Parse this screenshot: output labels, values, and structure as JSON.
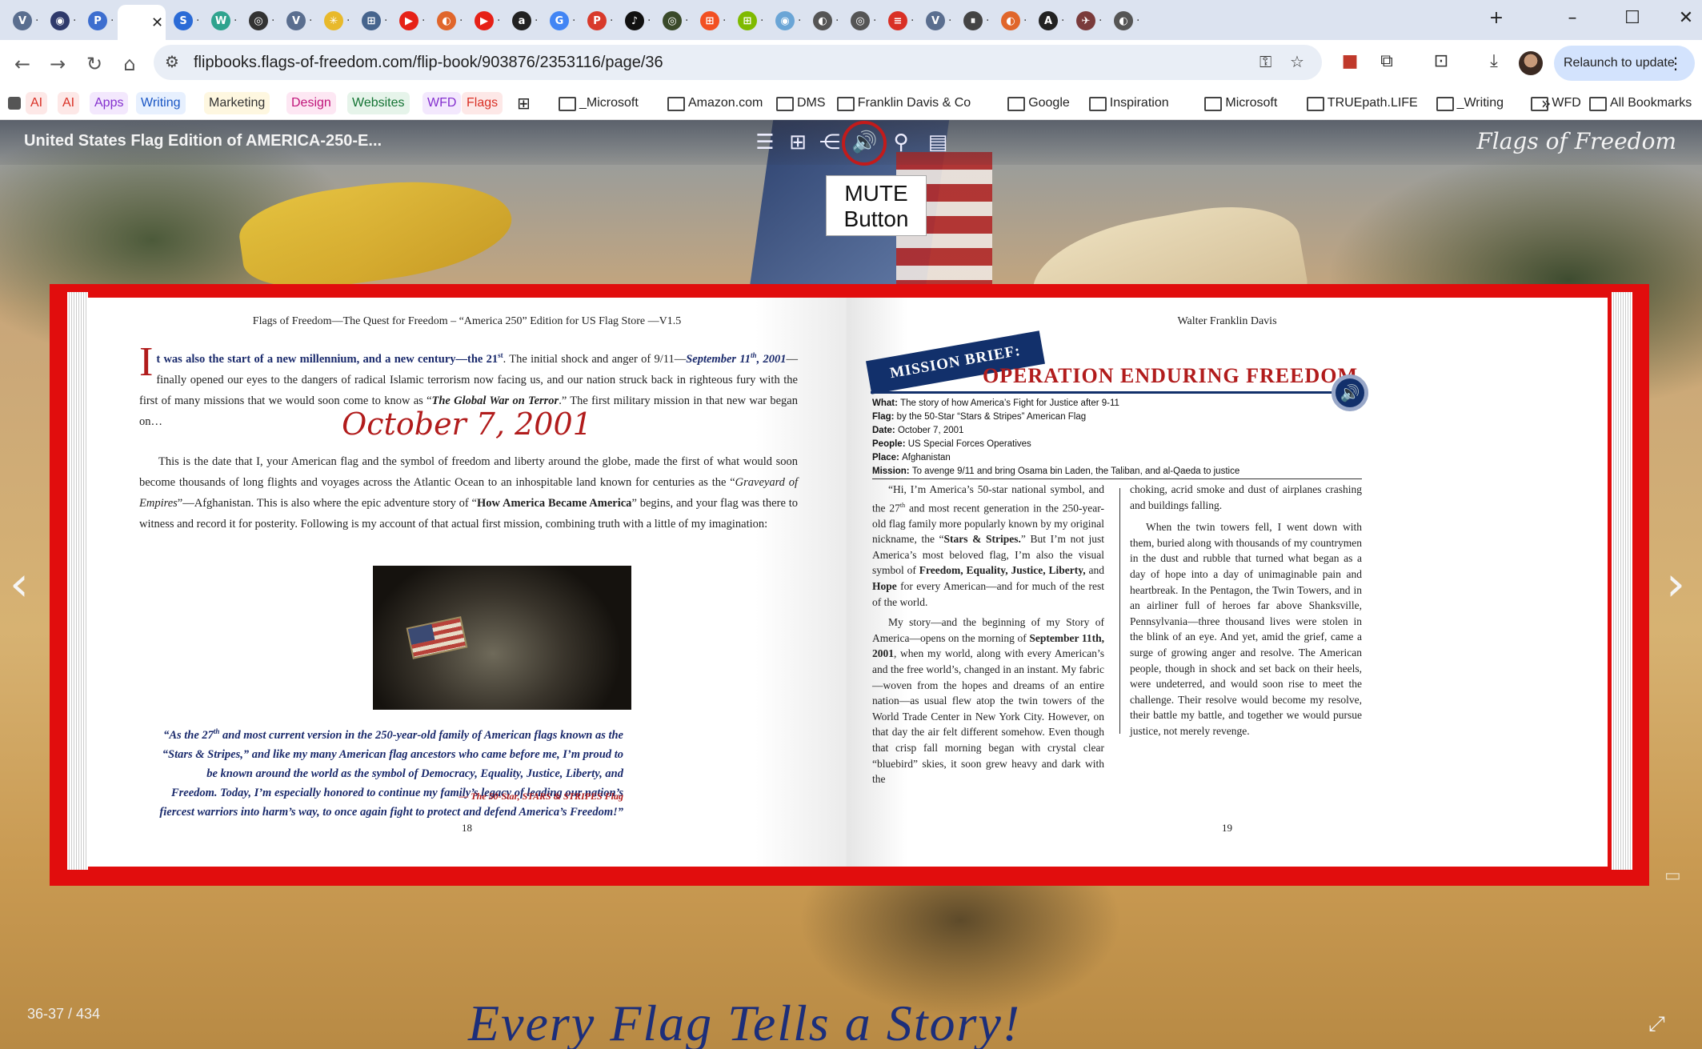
{
  "browser": {
    "tabs": [
      {
        "icon": "V",
        "color": "#5a6e8f"
      },
      {
        "icon": "◉",
        "color": "#2f3a6b"
      },
      {
        "icon": "P",
        "color": "#3d6ecf"
      },
      {
        "icon": "",
        "color": "#ffffff",
        "active": true
      },
      {
        "icon": "S",
        "color": "#2b6bd6"
      },
      {
        "icon": "W",
        "color": "#2fa38e"
      },
      {
        "icon": "◎",
        "color": "#333333"
      },
      {
        "icon": "V",
        "color": "#5a6e8f"
      },
      {
        "icon": "✳",
        "color": "#e8b92b"
      },
      {
        "icon": "⊞",
        "color": "#46648d"
      },
      {
        "icon": "▶",
        "color": "#e62117"
      },
      {
        "icon": "◐",
        "color": "#e0662b"
      },
      {
        "icon": "▶",
        "color": "#e62117"
      },
      {
        "icon": "a",
        "color": "#222222"
      },
      {
        "icon": "G",
        "color": "#4285f4"
      },
      {
        "icon": "P",
        "color": "#d83a2b"
      },
      {
        "icon": "♪",
        "color": "#111111"
      },
      {
        "icon": "◎",
        "color": "#3a4a2a"
      },
      {
        "icon": "⊞",
        "color": "#f25022"
      },
      {
        "icon": "⊞",
        "color": "#7fba00"
      },
      {
        "icon": "◉",
        "color": "#6aa5d6"
      },
      {
        "icon": "◐",
        "color": "#555555"
      },
      {
        "icon": "◎",
        "color": "#555555"
      },
      {
        "icon": "≡",
        "color": "#d93025"
      },
      {
        "icon": "V",
        "color": "#5a6e8f"
      },
      {
        "icon": "⏸",
        "color": "#444444"
      },
      {
        "icon": "◐",
        "color": "#e0662b"
      },
      {
        "icon": "A",
        "color": "#222222"
      },
      {
        "icon": "✈",
        "color": "#7a3b3b"
      },
      {
        "icon": "◐",
        "color": "#555555"
      }
    ],
    "url": "flipbooks.flags-of-freedom.com/flip-book/903876/2353116/page/36",
    "relaunch_label": "Relaunch to update",
    "bookmarks": [
      {
        "label": "AI",
        "color": "#d93025",
        "bg": "#fde8e7"
      },
      {
        "label": "AI",
        "color": "#d93025",
        "bg": "#fde8e7"
      },
      {
        "label": "Apps",
        "color": "#8430ce",
        "bg": "#f3e8fd"
      },
      {
        "label": "Writing",
        "color": "#1a56c4",
        "bg": "#e7f0fe"
      },
      {
        "label": "Marketing",
        "color": "#333333",
        "bg": "#fef7e0"
      },
      {
        "label": "Design",
        "color": "#c0157a",
        "bg": "#fde7f3"
      },
      {
        "label": "Websites",
        "color": "#137333",
        "bg": "#e6f4ea"
      },
      {
        "label": "WFD",
        "color": "#8430ce",
        "bg": "#f3e8fd"
      },
      {
        "label": "Flags",
        "color": "#d93025",
        "bg": "#fde8e7"
      }
    ],
    "folders": [
      "_Microsoft",
      "Amazon.com",
      "DMS",
      "Franklin Davis & Co",
      "Google",
      "Inspiration",
      "Microsoft",
      "TRUEpath.LIFE",
      "_Writing",
      "WFD"
    ],
    "all_bookmarks": "All Bookmarks"
  },
  "viewer": {
    "title": "United States Flag Edition of AMERICA-250-E...",
    "logo": "Flags of Freedom",
    "toolbar_icons": [
      "table-of-contents-icon",
      "thumbnails-icon",
      "share-icon",
      "sound-icon",
      "search-icon",
      "notes-icon"
    ],
    "callout": [
      "MUTE",
      "Button"
    ],
    "page_count": "36-37 / 434",
    "slogan": "Every Flag Tells a Story!"
  },
  "left_page": {
    "running_head": "Flags of Freedom—The Quest for Freedom – “America 250” Edition for US Flag Store —V1.5",
    "dropcap": "I",
    "intro_bold": "t was also the start of a new millennium, and a new century—the 21",
    "intro_sup": "st",
    "intro_text1": ". The initial shock and anger of 9/11—",
    "intro_date": "September 11",
    "intro_date_sup": "th",
    "intro_date_year": ", 2001",
    "intro_text2": "—finally opened our eyes to the dangers of radical Islamic terrorism now facing us, and our nation struck back in righteous fury with the first of many missions that we would soon come to know as “",
    "intro_gwot": "The Global War on Terror",
    "intro_text3": ".” The first military mission in that new war began on…",
    "date_heading": "October 7, 2001",
    "p2_a": "This is the date that I, your American flag and the symbol of freedom and liberty around the globe, made the first of what would soon become thousands of long flights and voyages across the Atlantic Ocean to an inhospitable land known for centuries as the “",
    "p2_grave": "Graveyard of Empires",
    "p2_b": "”—Afghanistan. This is also where the epic adventure story of “",
    "p2_how": "How America Became America",
    "p2_c": "” begins, and your flag was there to witness and record it for posterity. Following is my account of that actual first mission, combining truth with a little of my imagination:",
    "quote_a": "“As the 27",
    "quote_sup": "th",
    "quote_b": " and most current version in the 250-year-old family of American flags known as the “Stars & Stripes,” and like my many American flag ancestors who came before me, I’m proud to be known around the world as the symbol of Democracy, Equality, Justice, Liberty, and Freedom. Today, I’m especially honored to continue my family’s legacy of leading our nation’s fiercest warriors into harm’s way, to once again fight to protect and defend America’s Freedom!”",
    "quote_attr": "— The 50-Star, STARS & STRIPES Flag",
    "page_number": "18"
  },
  "right_page": {
    "running_head": "Walter Franklin Davis",
    "banner": "MISSION BRIEF:",
    "op_title": "OPERATION ENDURING FREEDOM",
    "facts": [
      {
        "k": "What:",
        "v": "The story of how America’s Fight for Justice after 9-11"
      },
      {
        "k": "Flag:",
        "v": "by the 50-Star “Stars & Stripes” American Flag"
      },
      {
        "k": "Date:",
        "v": "October 7, 2001"
      },
      {
        "k": "People:",
        "v": "US Special Forces Operatives"
      },
      {
        "k": "Place:",
        "v": "Afghanistan"
      },
      {
        "k": "Mission:",
        "v": "To avenge 9/11 and bring Osama bin Laden, the Taliban, and al-Qaeda to justice"
      }
    ],
    "col1_p1_a": "“Hi, I’m America’s 50-star national symbol, and the 27",
    "col1_p1_sup": "th",
    "col1_p1_b": " and most recent generation in the 250-year-old flag family more popularly known by my original nickname, the “",
    "col1_p1_stars": "Stars & Stripes.",
    "col1_p1_c": "” But I’m not just America’s most beloved flag, I’m also the visual symbol of ",
    "col1_p1_values": "Freedom, Equality, Justice, Liberty,",
    "col1_p1_and": " and ",
    "col1_p1_hope": "Hope",
    "col1_p1_d": " for every American—and for much of the rest of the world.",
    "col1_p2_a": "My story—and the beginning of my Story of America—opens on the morning of ",
    "col1_p2_date": "September 11th, 2001",
    "col1_p2_b": ", when my world, along with every American’s and the free world’s, changed in an instant. My fabric—woven from the hopes and dreams of an entire nation—as usual flew atop the twin towers of the World Trade Center in New York City. However, on that day the air felt different somehow. Even though that crisp fall morning began with crystal clear “bluebird” skies, it soon grew heavy and dark with the",
    "col2_p1": "choking, acrid smoke and dust of airplanes crashing and buildings falling.",
    "col2_p2": "When the twin towers fell, I went down with them, buried along with thousands of my countrymen in the dust and rubble that turned what began as a day of hope into a day of unimaginable pain and heartbreak. In the Pentagon, the Twin Towers, and in an airliner full of heroes far above Shanksville, Pennsylvania—three thousand lives were stolen in the blink of an eye. And yet, amid the grief, came a surge of growing anger and resolve. The American people, though in shock and set back on their heels, were undeterred, and would soon rise to meet the challenge. Their resolve would become my resolve, their battle my battle, and together we would pursue justice, not merely revenge.",
    "page_number": "19"
  }
}
